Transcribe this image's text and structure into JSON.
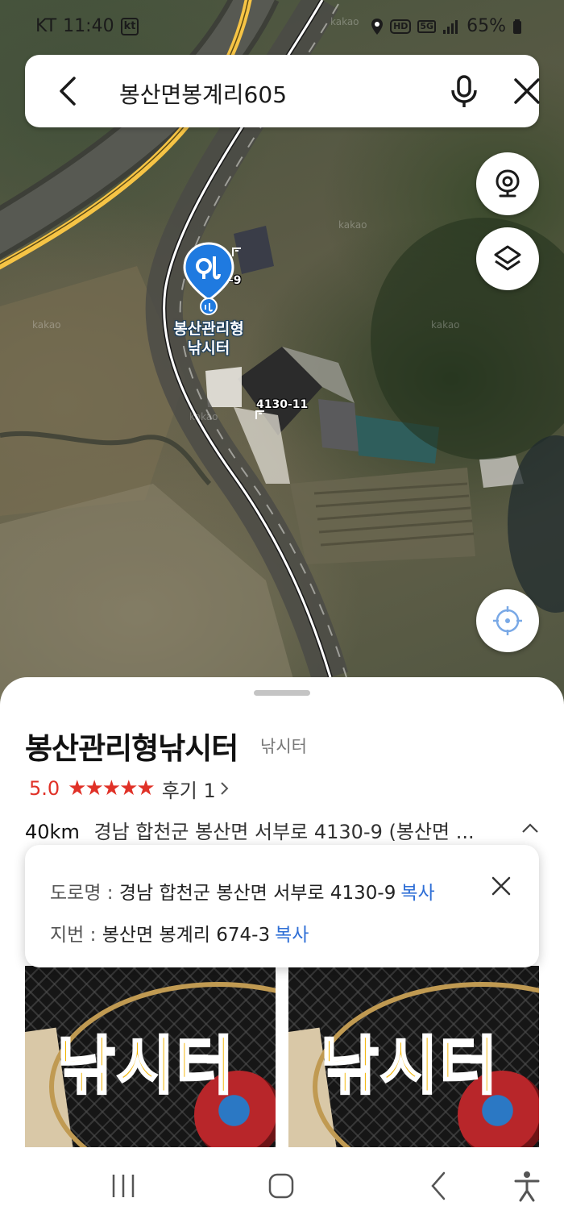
{
  "status_bar": {
    "carrier": "KT",
    "time": "11:40",
    "carrier_badge": "kt",
    "hd": "HD",
    "network": "5G",
    "battery": "65%"
  },
  "search": {
    "query": "봉산면봉계리605"
  },
  "map": {
    "marker_label": "봉산관리형\n낚시터",
    "addr_label_1": "-9",
    "addr_label_2": "4130-11",
    "watermark": "kakao"
  },
  "place": {
    "name": "봉산관리형낚시터",
    "category": "낚시터",
    "rating": "5.0",
    "stars": "★★★★★",
    "reviews": "후기 1",
    "distance": "40km",
    "address_short": "경남 합천군 봉산면 서부로 4130-9 (봉산면 ..."
  },
  "address_popup": {
    "road_label": "도로명 : ",
    "road_value": "경남 합천군 봉산면 서부로 4130-9",
    "lot_label": "지번 : ",
    "lot_value": "봉산면 봉계리 674-3",
    "copy": "복사"
  },
  "photos": [
    {
      "text": "낚시터"
    },
    {
      "text": "낚시터"
    }
  ],
  "colors": {
    "accent_red": "#e03127",
    "link_blue": "#2f6fd6",
    "marker_blue": "#1f7ae0"
  },
  "icons": {
    "back": "back-arrow-icon",
    "mic": "microphone-icon",
    "close": "close-icon",
    "streetview": "streetview-icon",
    "layers": "layers-icon",
    "locate": "my-location-icon"
  }
}
